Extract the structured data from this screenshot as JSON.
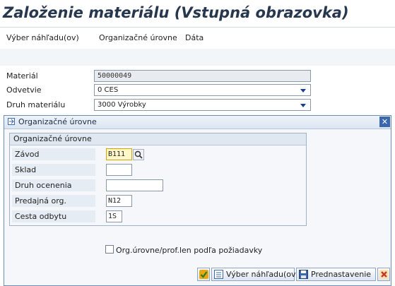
{
  "window": {
    "title": "Založenie materiálu (Vstupná obrazovka)"
  },
  "menu": {
    "items": [
      {
        "label": "Výber náhľadu(ov)"
      },
      {
        "label": "Organizačné úrovne"
      },
      {
        "label": "Dáta"
      }
    ]
  },
  "form": {
    "material": {
      "label": "Materiál",
      "value": "50000049"
    },
    "industry": {
      "label": "Odvetvie",
      "value": "0 CES"
    },
    "material_type": {
      "label": "Druh materiálu",
      "value": "3000 Výrobky"
    }
  },
  "dialog": {
    "title": "Organizačné úrovne",
    "group_title": "Organizačné úrovne",
    "fields": [
      {
        "label": "Závod",
        "value": "B111"
      },
      {
        "label": "Sklad",
        "value": ""
      },
      {
        "label": "Druh ocenenia",
        "value": ""
      },
      {
        "label": "Predajná org.",
        "value": "N12"
      },
      {
        "label": "Cesta odbytu",
        "value": "1S"
      }
    ],
    "checkbox_label": "Org.úrovne/prof.len podľa požiadavky",
    "buttons": {
      "select_views": "Výber náhľadu(ov)",
      "defaults": "Prednastavenie"
    },
    "close_glyph": "✕"
  },
  "colors": {
    "title": "#26374e",
    "dialog_border": "#6d8db5",
    "confirm": "#e6a817",
    "cancel": "#c0392b"
  }
}
